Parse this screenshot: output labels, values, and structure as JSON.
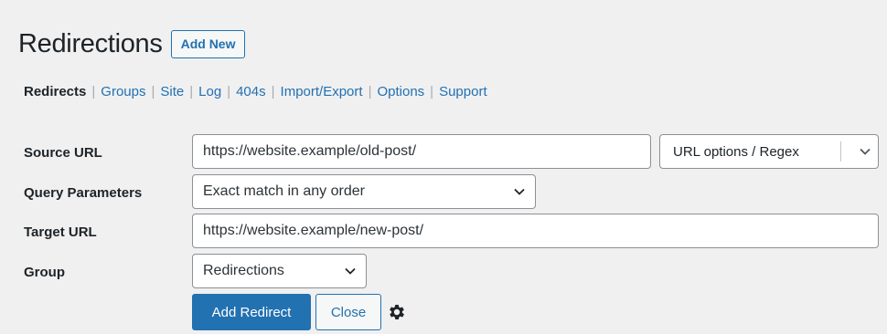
{
  "header": {
    "title": "Redirections",
    "add_new_label": "Add New"
  },
  "subnav": {
    "items": [
      {
        "label": "Redirects",
        "current": true
      },
      {
        "label": "Groups"
      },
      {
        "label": "Site"
      },
      {
        "label": "Log"
      },
      {
        "label": "404s"
      },
      {
        "label": "Import/Export"
      },
      {
        "label": "Options"
      },
      {
        "label": "Support"
      }
    ],
    "separator": "|"
  },
  "form": {
    "source_url": {
      "label": "Source URL",
      "value": "https://website.example/old-post/"
    },
    "url_options": {
      "label": "URL options / Regex",
      "icon": "chevron-down-icon"
    },
    "query_parameters": {
      "label": "Query Parameters",
      "value": "Exact match in any order",
      "icon": "chevron-down-icon"
    },
    "target_url": {
      "label": "Target URL",
      "value": "https://website.example/new-post/"
    },
    "group": {
      "label": "Group",
      "value": "Redirections",
      "icon": "chevron-down-icon"
    },
    "add_redirect_label": "Add Redirect",
    "close_label": "Close",
    "settings_icon": "gear-icon"
  },
  "colors": {
    "accent": "#2271b1",
    "background": "#f0f0f1",
    "text": "#1d2327",
    "border": "#8c8f94"
  }
}
